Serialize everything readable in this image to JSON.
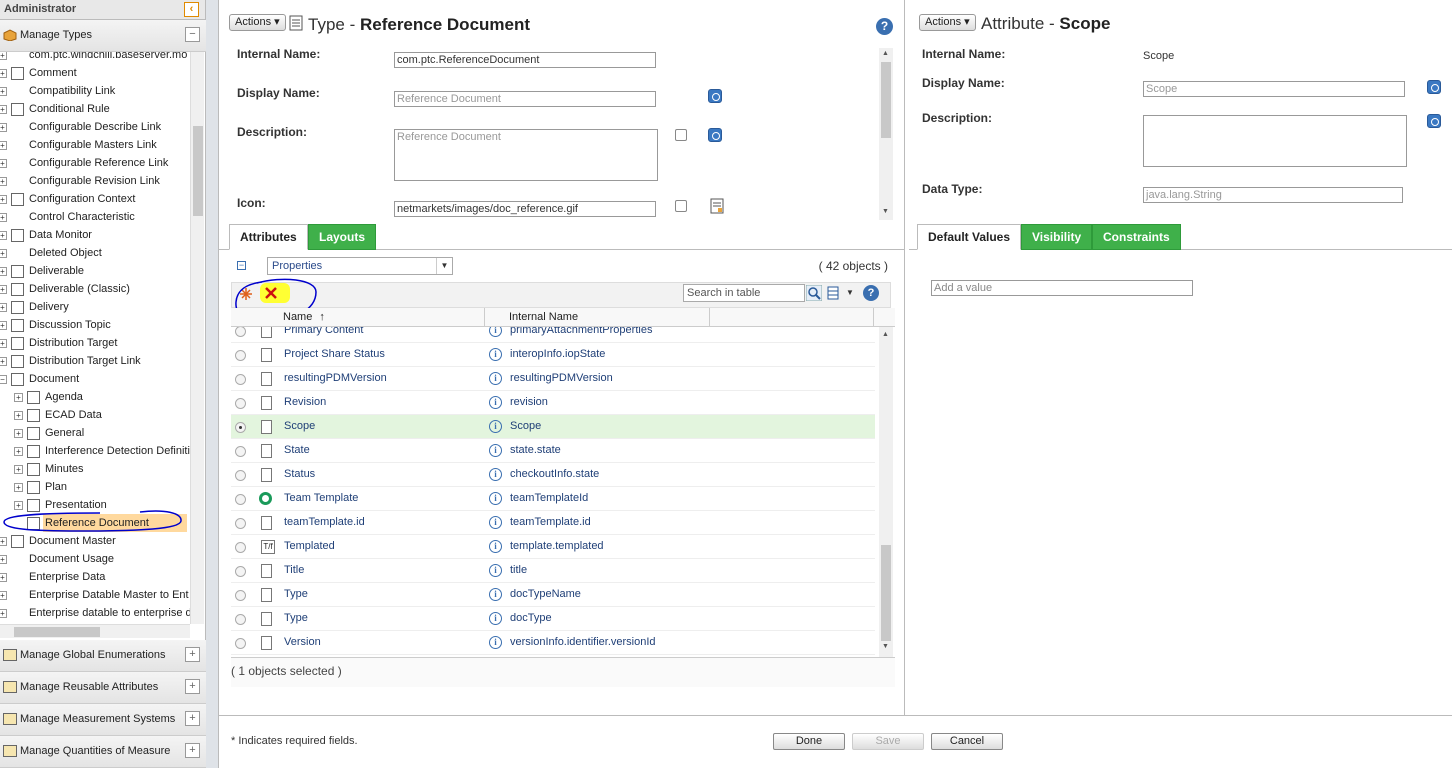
{
  "sidebar": {
    "header": "Administrator",
    "collapse_icon": "chevron-left-icon",
    "manage_types": "Manage Types",
    "tree": [
      {
        "label": "com.ptc.windchill.baseserver.mo",
        "indent": 0,
        "toggle": "+",
        "icon": "none"
      },
      {
        "label": "Comment",
        "indent": 0,
        "toggle": "+",
        "icon": "comment-icon"
      },
      {
        "label": "Compatibility Link",
        "indent": 0,
        "toggle": "+",
        "icon": "none"
      },
      {
        "label": "Conditional Rule",
        "indent": 0,
        "toggle": "+",
        "icon": "rule-icon"
      },
      {
        "label": "Configurable Describe Link",
        "indent": 0,
        "toggle": "+",
        "icon": "none"
      },
      {
        "label": "Configurable Masters Link",
        "indent": 0,
        "toggle": "+",
        "icon": "none"
      },
      {
        "label": "Configurable Reference Link",
        "indent": 0,
        "toggle": "+",
        "icon": "none"
      },
      {
        "label": "Configurable Revision Link",
        "indent": 0,
        "toggle": "+",
        "icon": "none"
      },
      {
        "label": "Configuration Context",
        "indent": 0,
        "toggle": "+",
        "icon": "gear-icon"
      },
      {
        "label": "Control Characteristic",
        "indent": 0,
        "toggle": "+",
        "icon": "none"
      },
      {
        "label": "Data Monitor",
        "indent": 0,
        "toggle": "+",
        "icon": "chart-icon"
      },
      {
        "label": "Deleted Object",
        "indent": 0,
        "toggle": "+",
        "icon": "none"
      },
      {
        "label": "Deliverable",
        "indent": 0,
        "toggle": "+",
        "icon": "box-icon"
      },
      {
        "label": "Deliverable (Classic)",
        "indent": 0,
        "toggle": "+",
        "icon": "box-icon"
      },
      {
        "label": "Delivery",
        "indent": 0,
        "toggle": "+",
        "icon": "delivery-icon"
      },
      {
        "label": "Discussion Topic",
        "indent": 0,
        "toggle": "+",
        "icon": "discussion-icon"
      },
      {
        "label": "Distribution Target",
        "indent": 0,
        "toggle": "+",
        "icon": "target-icon"
      },
      {
        "label": "Distribution Target Link",
        "indent": 0,
        "toggle": "+",
        "icon": "target-icon"
      },
      {
        "label": "Document",
        "indent": 0,
        "toggle": "−",
        "icon": "document-icon"
      },
      {
        "label": "Agenda",
        "indent": 1,
        "toggle": "+",
        "icon": "list-icon"
      },
      {
        "label": "ECAD Data",
        "indent": 1,
        "toggle": "+",
        "icon": "document-icon"
      },
      {
        "label": "General",
        "indent": 1,
        "toggle": "+",
        "icon": "document-icon"
      },
      {
        "label": "Interference Detection Definiti",
        "indent": 1,
        "toggle": "+",
        "icon": "interference-icon"
      },
      {
        "label": "Minutes",
        "indent": 1,
        "toggle": "+",
        "icon": "list-icon"
      },
      {
        "label": "Plan",
        "indent": 1,
        "toggle": "+",
        "icon": "list-icon"
      },
      {
        "label": "Presentation",
        "indent": 1,
        "toggle": "+",
        "icon": "presentation-icon"
      },
      {
        "label": "Reference Document",
        "indent": 1,
        "toggle": "",
        "icon": "document-icon",
        "selected": true
      },
      {
        "label": "Document Master",
        "indent": 0,
        "toggle": "+",
        "icon": "document-master-icon"
      },
      {
        "label": "Document Usage",
        "indent": 0,
        "toggle": "+",
        "icon": "none"
      },
      {
        "label": "Enterprise Data",
        "indent": 0,
        "toggle": "+",
        "icon": "none"
      },
      {
        "label": "Enterprise Datable Master to Ent",
        "indent": 0,
        "toggle": "+",
        "icon": "none"
      },
      {
        "label": "Enterprise datable to enterprise d",
        "indent": 0,
        "toggle": "+",
        "icon": "none"
      }
    ],
    "sections": [
      {
        "label": "Manage Global Enumerations",
        "icon": "enumeration-icon"
      },
      {
        "label": "Manage Reusable Attributes",
        "icon": "attributes-icon"
      },
      {
        "label": "Manage Measurement Systems",
        "icon": "measurement-icon"
      },
      {
        "label": "Manage Quantities of Measure",
        "icon": "ruler-icon"
      }
    ]
  },
  "type_panel": {
    "actions_label": "Actions",
    "title_prefix": "Type - ",
    "title_name": "Reference Document",
    "fields": {
      "internal_name_label": "Internal Name:",
      "internal_name_value": "com.ptc.ReferenceDocument",
      "display_name_label": "Display Name:",
      "display_name_value": "Reference Document",
      "description_label": "Description:",
      "description_value": "Reference Document",
      "icon_label": "Icon:",
      "icon_value": "netmarkets/images/doc_reference.gif"
    },
    "tabs": [
      "Attributes",
      "Layouts"
    ],
    "view_select": "Properties",
    "object_count": "( 42 objects )",
    "search_placeholder": "Search in table",
    "columns": [
      "Name",
      "Internal Name"
    ],
    "sort_indicator": "↑",
    "rows": [
      {
        "name": "Primary Content",
        "internal": "primaryAttachmentProperties",
        "icon": "document-icon"
      },
      {
        "name": "Project Share Status",
        "internal": "interopInfo.iopState",
        "icon": "document-icon"
      },
      {
        "name": "resultingPDMVersion",
        "internal": "resultingPDMVersion",
        "icon": "document-icon"
      },
      {
        "name": "Revision",
        "internal": "revision",
        "icon": "document-icon"
      },
      {
        "name": "Scope",
        "internal": "Scope",
        "icon": "document-icon",
        "selected": true
      },
      {
        "name": "State",
        "internal": "state.state",
        "icon": "document-icon"
      },
      {
        "name": "Status",
        "internal": "checkoutInfo.state",
        "icon": "document-icon"
      },
      {
        "name": "Team Template",
        "internal": "teamTemplateId",
        "icon": "team-template-icon"
      },
      {
        "name": "teamTemplate.id",
        "internal": "teamTemplate.id",
        "icon": "document-icon"
      },
      {
        "name": "Templated",
        "internal": "template.templated",
        "icon": "template-icon"
      },
      {
        "name": "Title",
        "internal": "title",
        "icon": "document-icon"
      },
      {
        "name": "Type",
        "internal": "docTypeName",
        "icon": "document-icon"
      },
      {
        "name": "Type",
        "internal": "docType",
        "icon": "document-icon"
      },
      {
        "name": "Version",
        "internal": "versionInfo.identifier.versionId",
        "icon": "document-icon"
      }
    ],
    "selected_count": "( 1 objects selected )"
  },
  "attr_panel": {
    "actions_label": "Actions",
    "title_prefix": "Attribute - ",
    "title_name": "Scope",
    "internal_name_label": "Internal Name:",
    "internal_name_value": "Scope",
    "display_name_label": "Display Name:",
    "display_name_value": "Scope",
    "description_label": "Description:",
    "data_type_label": "Data Type:",
    "data_type_value": "java.lang.String",
    "tabs": [
      "Default Values",
      "Visibility",
      "Constraints"
    ],
    "add_value_placeholder": "Add a value"
  },
  "footer": {
    "required_note": "* Indicates required fields.",
    "done": "Done",
    "save": "Save",
    "cancel": "Cancel"
  },
  "colors": {
    "accent_green": "#3fb04a",
    "selection": "#ffd99e",
    "annotation": "#0000cc",
    "highlight": "#ffff33"
  }
}
